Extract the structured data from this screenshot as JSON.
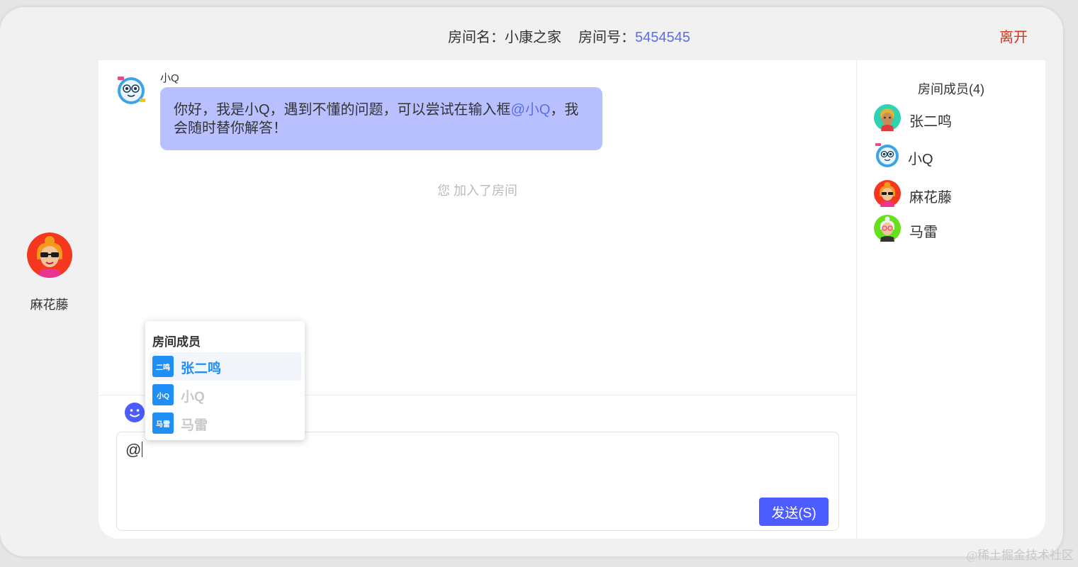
{
  "header": {
    "room_name_label": "房间名：",
    "room_name": "小康之家",
    "room_id_label": "房间号：",
    "room_id": "5454545",
    "leave_label": "离开"
  },
  "profile": {
    "name": "麻花藤"
  },
  "chat": {
    "messages": [
      {
        "sender": "小Q",
        "text_before": "你好，我是小Q，遇到不懂的问题，可以尝试在输入框",
        "mention": "@小Q",
        "text_after": "，我会随时替你解答！"
      }
    ],
    "system_notice": "您 加入了房间"
  },
  "input": {
    "value": "@",
    "send_label": "发送(S)"
  },
  "mention_popup": {
    "title": "房间成员",
    "items": [
      {
        "tag": "二鸣",
        "name": "张二鸣",
        "active": true
      },
      {
        "tag": "小Q",
        "name": "小Q",
        "active": false
      },
      {
        "tag": "马雷",
        "name": "马雷",
        "active": false
      }
    ]
  },
  "members": {
    "title": "房间成员(4)",
    "list": [
      {
        "name": "张二鸣"
      },
      {
        "name": "小Q"
      },
      {
        "name": "麻花藤"
      },
      {
        "name": "马雷"
      }
    ]
  },
  "colors": {
    "accent": "#4c5cff",
    "bubble": "#b8c0ff",
    "mention": "#5a6ee6",
    "leave": "#d6341c",
    "tag": "#1f8ff5"
  },
  "watermark": "@稀土掘金技术社区"
}
